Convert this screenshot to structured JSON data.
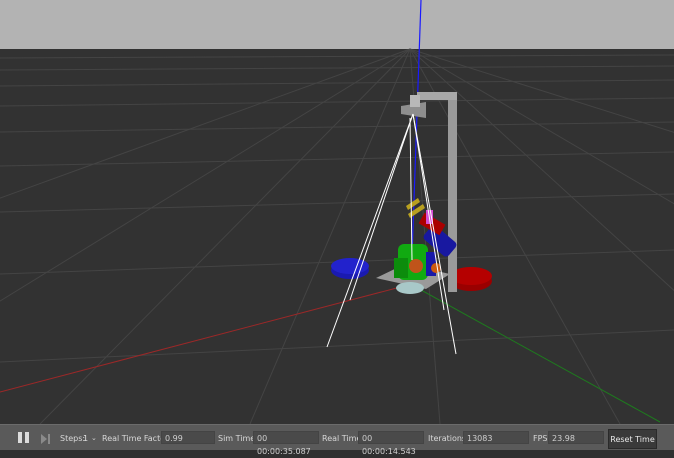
{
  "toolbar": {
    "pause_icon": "pause-icon",
    "step_icon": "step-forward-icon",
    "steps_label": "Steps:",
    "steps_value": "1",
    "real_time_factor_label": "Real Time Factor:",
    "real_time_factor_value": "0.99",
    "sim_time_label": "Sim Time:",
    "sim_time_value": "00 00:00:35.087",
    "real_time_label": "Real Time:",
    "real_time_value": "00 00:00:14.543",
    "iterations_label": "Iterations:",
    "iterations_value": "13083",
    "fps_label": "FPS:",
    "fps_value": "23.98",
    "reset_time_label": "Reset Time"
  },
  "colors": {
    "sky": "#b3b3b3",
    "ground": "#323232",
    "grid": "#454545",
    "axis_x": "#b52a2a",
    "axis_y": "#1f8a1f",
    "axis_z": "#1a1aff"
  }
}
